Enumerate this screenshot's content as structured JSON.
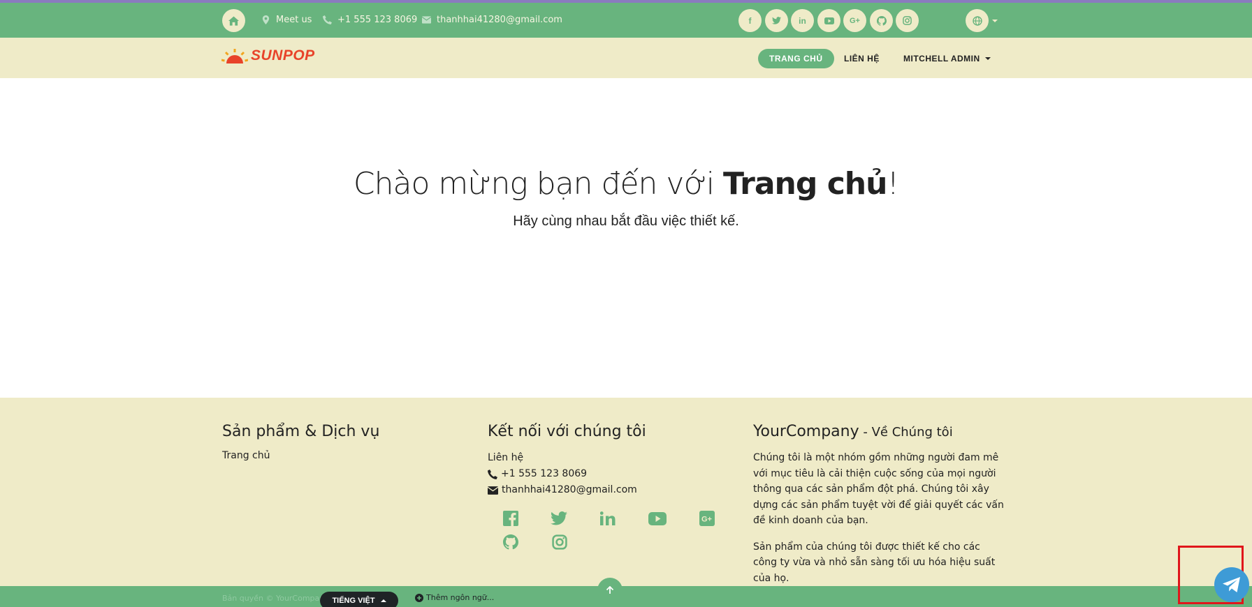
{
  "topbar": {
    "meet_us": "Meet us",
    "phone": "+1 555 123 8069",
    "email": "thanhhai41280@gmail.com",
    "social_icons": [
      "facebook-icon",
      "twitter-icon",
      "linkedin-icon",
      "youtube-icon",
      "google-plus-icon",
      "github-icon",
      "instagram-icon"
    ]
  },
  "navbar": {
    "logo_text": "SUNPOP",
    "items": [
      {
        "label": "TRANG CHỦ",
        "active": true
      },
      {
        "label": "LIÊN HỆ",
        "active": false
      },
      {
        "label": "MITCHELL ADMIN",
        "active": false
      }
    ]
  },
  "hero": {
    "title_prefix": "Chào mừng bạn đến với ",
    "title_bold": "Trang chủ",
    "title_suffix": "!",
    "subtitle": "Hãy cùng nhau bắt đầu việc thiết kế."
  },
  "footer": {
    "col1": {
      "heading": "Sản phẩm & Dịch vụ",
      "link": "Trang chủ"
    },
    "col2": {
      "heading": "Kết nối với chúng tôi",
      "contact_link": "Liên hệ",
      "phone": "+1 555 123 8069",
      "email": "thanhhai41280@gmail.com"
    },
    "col3": {
      "heading": "YourCompany",
      "heading_small": " - Về Chúng tôi",
      "para1": "Chúng tôi là một nhóm gồm những người đam mê với mục tiêu là cải thiện cuộc sống của mọi người thông qua các sản phẩm đột phá. Chúng tôi xây dựng các sản phẩm tuyệt vời để giải quyết các vấn đề kinh doanh của bạn.",
      "para2": "Sản phẩm của chúng tôi được thiết kế cho các công ty vừa và nhỏ sẵn sàng tối ưu hóa hiệu suất của họ."
    }
  },
  "bottombar": {
    "copyright": "Bản quyền © YourCompany",
    "language": "TIẾNG VIỆT",
    "add_language": "Thêm ngôn ngữ..."
  },
  "colors": {
    "green": "#68b47e",
    "cream": "#efebc8",
    "logo_red": "#e8432a",
    "telegram": "#3e9bd6"
  }
}
